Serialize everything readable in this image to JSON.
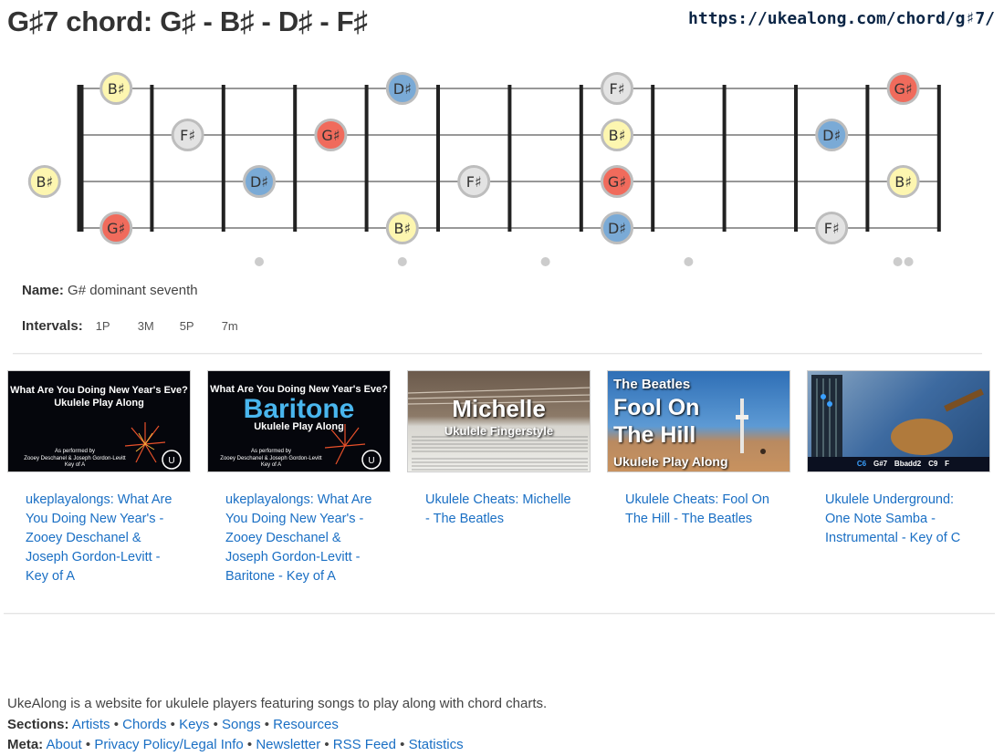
{
  "page": {
    "title": "G♯7 chord: G♯ - B♯ - D♯ - F♯",
    "url": "https://ukealong.com/chord/g♯7/"
  },
  "fretboard": {
    "strings": 4,
    "frets": 12,
    "notes": [
      {
        "string": 1,
        "fret": 0,
        "label": "B♯",
        "color": "#fdf6b0"
      },
      {
        "string": 1,
        "fret": 4,
        "label": "D♯",
        "color": "#7aaad6"
      },
      {
        "string": 1,
        "fret": 7,
        "label": "F♯",
        "color": "#e3e3e3"
      },
      {
        "string": 1,
        "fret": 11,
        "label": "G♯",
        "color": "#f06b5c"
      },
      {
        "string": 2,
        "fret": 1,
        "label": "F♯",
        "color": "#e3e3e3"
      },
      {
        "string": 2,
        "fret": 3,
        "label": "G♯",
        "color": "#f06b5c"
      },
      {
        "string": 2,
        "fret": 7,
        "label": "B♯",
        "color": "#fdf6b0"
      },
      {
        "string": 2,
        "fret": 10,
        "label": "D♯",
        "color": "#7aaad6"
      },
      {
        "string": 3,
        "fret": -1,
        "label": "B♯",
        "color": "#fdf6b0"
      },
      {
        "string": 3,
        "fret": 2,
        "label": "D♯",
        "color": "#7aaad6"
      },
      {
        "string": 3,
        "fret": 5,
        "label": "F♯",
        "color": "#e3e3e3"
      },
      {
        "string": 3,
        "fret": 7,
        "label": "G♯",
        "color": "#f06b5c"
      },
      {
        "string": 3,
        "fret": 11,
        "label": "B♯",
        "color": "#fdf6b0"
      },
      {
        "string": 4,
        "fret": 0,
        "label": "G♯",
        "color": "#f06b5c"
      },
      {
        "string": 4,
        "fret": 4,
        "label": "B♯",
        "color": "#fdf6b0"
      },
      {
        "string": 4,
        "fret": 7,
        "label": "D♯",
        "color": "#7aaad6"
      },
      {
        "string": 4,
        "fret": 10,
        "label": "F♯",
        "color": "#e3e3e3"
      }
    ],
    "markers": [
      {
        "fret": 3,
        "count": 1
      },
      {
        "fret": 5,
        "count": 1
      },
      {
        "fret": 7,
        "count": 1
      },
      {
        "fret": 9,
        "count": 1
      },
      {
        "fret": 12,
        "count": 2
      }
    ]
  },
  "info": {
    "name_label": "Name:",
    "name_value": "G# dominant seventh",
    "intervals_label": "Intervals:",
    "intervals": [
      "1P",
      "3M",
      "5P",
      "7m"
    ]
  },
  "videos": [
    {
      "link": "ukeplayalongs: What Are You Doing New Year's - Zooey Deschanel & Joseph Gordon-Levitt - Key of A",
      "thumb": {
        "line1": "What Are You Doing New Year's Eve?",
        "line2": "Ukulele Play Along",
        "line3": "As performed by",
        "line4": "Zooey Deschanel & Joseph Gordon-Levitt",
        "line5": "Key of A"
      }
    },
    {
      "link": "ukeplayalongs: What Are You Doing New Year's - Zooey Deschanel & Joseph Gordon-Levitt - Baritone - Key of A",
      "thumb": {
        "line1": "What Are You Doing New Year's Eve?",
        "big": "Baritone",
        "line2": "Ukulele Play Along",
        "line3": "As performed by",
        "line4": "Zooey Deschanel & Joseph Gordon-Levitt",
        "line5": "Key of A"
      }
    },
    {
      "link": "Ukulele Cheats: Michelle - The Beatles",
      "thumb": {
        "big": "Michelle",
        "line2": "Ukulele Fingerstyle"
      }
    },
    {
      "link": "Ukulele Cheats: Fool On The Hill - The Beatles",
      "thumb": {
        "line1": "The Beatles",
        "big1": "Fool On",
        "big2": "The Hill",
        "line2": "Ukulele Play Along"
      }
    },
    {
      "link": "Ukulele Underground: One Note Samba - Instrumental - Key of C",
      "thumb": {
        "chords": [
          "C6",
          "G#7",
          "Bbadd2",
          "C9",
          "F"
        ]
      }
    }
  ],
  "about": {
    "text": "UkeAlong is a website for ukulele players featuring songs to play along with chord charts.",
    "sections_label": "Sections:",
    "sections": [
      "Artists",
      "Chords",
      "Keys",
      "Songs",
      "Resources"
    ],
    "meta_label": "Meta:",
    "meta": [
      "About",
      "Privacy Policy/Legal Info",
      "Newsletter",
      "RSS Feed",
      "Statistics"
    ]
  },
  "colors": {
    "link": "#1a6fc4",
    "title": "#333333",
    "url": "#0b2545",
    "note_red": "#f06b5c",
    "note_blue": "#7aaad6",
    "note_yellow": "#fdf6b0",
    "note_gray": "#e3e3e3"
  }
}
